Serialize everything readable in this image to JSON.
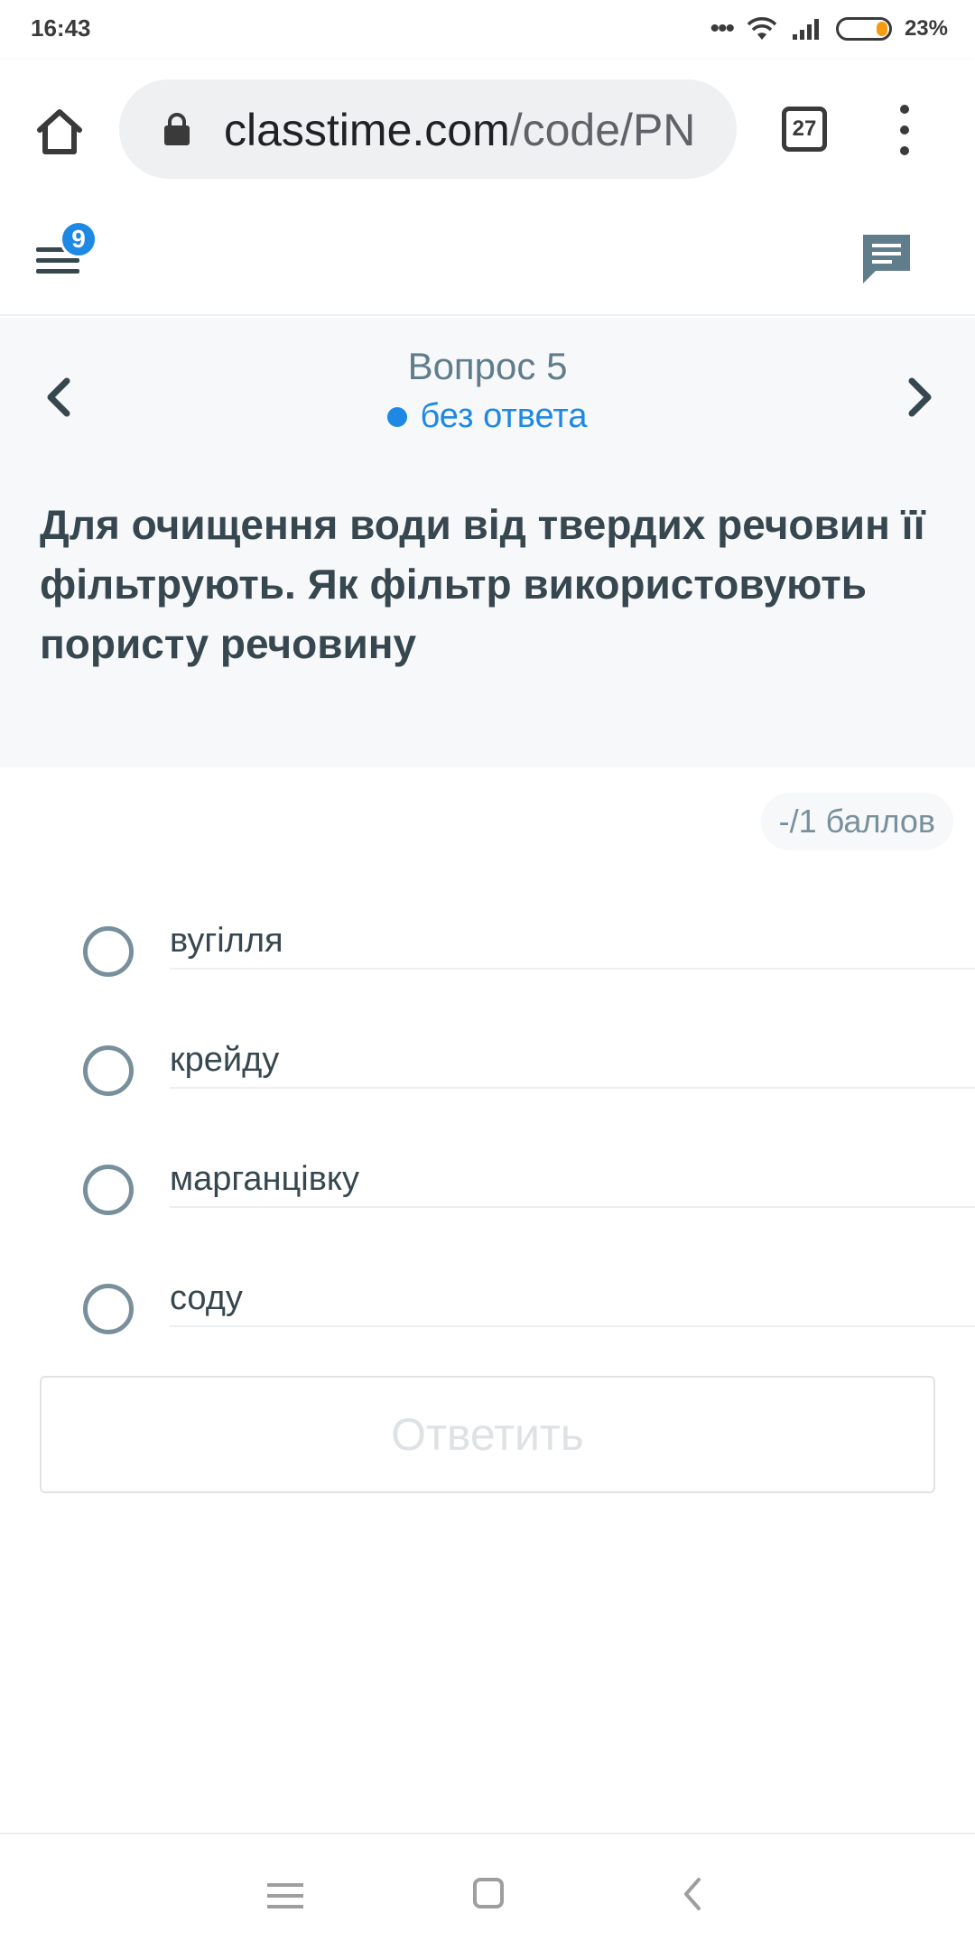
{
  "status_bar": {
    "time": "16:43",
    "battery_percent": "23%",
    "battery_level": 0.23,
    "dots": "•••"
  },
  "browser": {
    "url_domain": "classtime.com",
    "url_path": "/code/PN",
    "tab_count": "27"
  },
  "header": {
    "badge_count": "9"
  },
  "question": {
    "number_label": "Вопрос 5",
    "status_label": "без ответа",
    "text": "Для очищення води від твердих речовин її фільтрують. Як фільтр використовують пористу речовину"
  },
  "points": {
    "label": "-/1 баллов"
  },
  "options": [
    {
      "label": "вугілля"
    },
    {
      "label": "крейду"
    },
    {
      "label": "марганцівку"
    },
    {
      "label": "соду"
    }
  ],
  "submit": {
    "label": "Ответить"
  },
  "colors": {
    "accent": "#1e88e5",
    "text_dark": "#37474f",
    "text_muted": "#607d8b",
    "question_bg": "#f7f8fa",
    "battery": "#f39c12"
  }
}
